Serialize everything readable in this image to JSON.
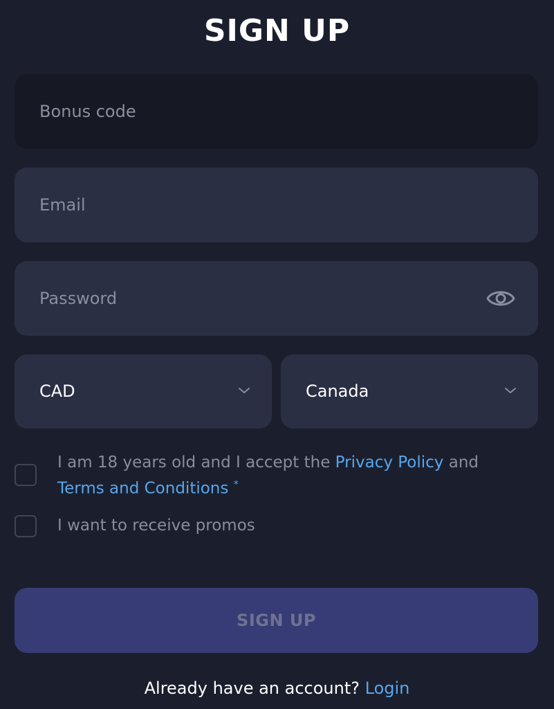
{
  "title": "SIGN UP",
  "bonus_field": {
    "placeholder": "Bonus code",
    "value": ""
  },
  "email_field": {
    "placeholder": "Email",
    "value": ""
  },
  "password_field": {
    "placeholder": "Password",
    "value": "",
    "icon": "eye-icon"
  },
  "currency_select": {
    "value": "CAD",
    "icon": "chevron-down-icon"
  },
  "country_select": {
    "value": "Canada",
    "icon": "chevron-down-icon"
  },
  "age_checkbox": {
    "checked": false,
    "text_before": "I am 18 years old and I accept the ",
    "privacy_link": "Privacy Policy",
    "text_middle": " and",
    "terms_link": "Terms and Conditions",
    "required_mark": "*"
  },
  "promos_checkbox": {
    "checked": false,
    "label": "I want to receive promos"
  },
  "submit_button": {
    "label": "SIGN UP"
  },
  "footer": {
    "prompt": "Already have an account?",
    "login_link": "Login"
  },
  "colors": {
    "background": "#1b1f2d",
    "field": "#2a2f43",
    "bonus_field": "#161923",
    "link": "#58a6ec",
    "button": "#373c77"
  }
}
